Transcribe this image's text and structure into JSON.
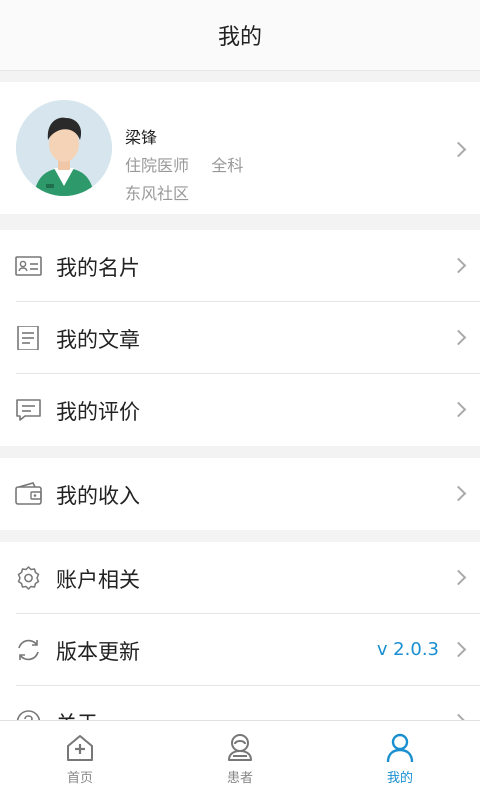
{
  "header": {
    "title": "我的"
  },
  "profile": {
    "name": "梁锋",
    "role": "住院医师",
    "department": "全科",
    "community": "东风社区"
  },
  "groups": [
    {
      "items": [
        {
          "icon": "id-card-icon",
          "label": "我的名片"
        },
        {
          "icon": "article-icon",
          "label": "我的文章"
        },
        {
          "icon": "review-icon",
          "label": "我的评价"
        }
      ]
    },
    {
      "items": [
        {
          "icon": "wallet-icon",
          "label": "我的收入"
        }
      ]
    },
    {
      "items": [
        {
          "icon": "gear-icon",
          "label": "账户相关"
        },
        {
          "icon": "refresh-icon",
          "label": "版本更新",
          "value": "v 2.0.3"
        },
        {
          "icon": "help-icon",
          "label": "关于"
        }
      ]
    }
  ],
  "tabs": [
    {
      "icon": "home-plus-icon",
      "label": "首页",
      "active": false
    },
    {
      "icon": "patient-icon",
      "label": "患者",
      "active": false
    },
    {
      "icon": "person-icon",
      "label": "我的",
      "active": true
    }
  ],
  "colors": {
    "accent": "#1a8fd0",
    "icon_gray": "#777777"
  }
}
